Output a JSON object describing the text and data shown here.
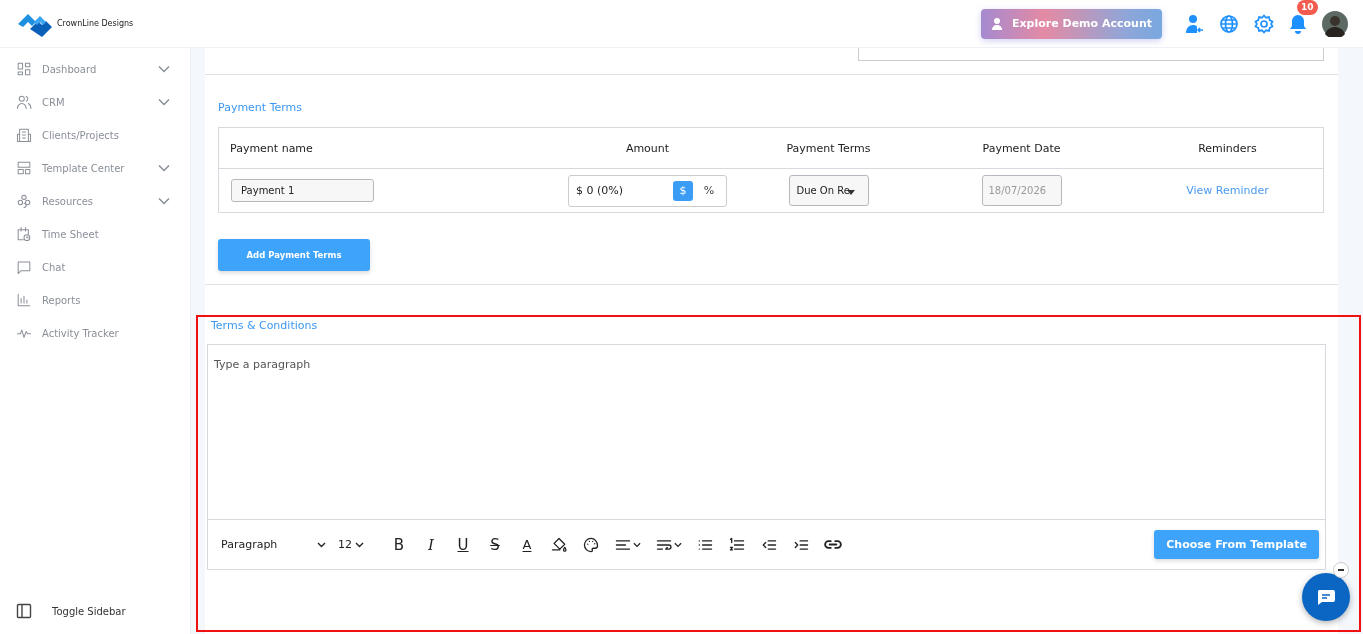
{
  "header": {
    "brand": "CrownLine Designs",
    "demo_button": "Explore Demo Account",
    "notification_count": "10"
  },
  "sidebar": {
    "items": [
      {
        "label": "Dashboard",
        "expandable": true
      },
      {
        "label": "CRM",
        "expandable": true
      },
      {
        "label": "Clients/Projects",
        "expandable": false
      },
      {
        "label": "Template Center",
        "expandable": true
      },
      {
        "label": "Resources",
        "expandable": true
      },
      {
        "label": "Time Sheet",
        "expandable": false
      },
      {
        "label": "Chat",
        "expandable": false
      },
      {
        "label": "Reports",
        "expandable": false
      },
      {
        "label": "Activity Tracker",
        "expandable": false
      }
    ],
    "toggle": "Toggle Sidebar"
  },
  "payment_terms": {
    "title": "Payment Terms",
    "columns": [
      "Payment name",
      "Amount",
      "Payment Terms",
      "Payment Date",
      "Reminders"
    ],
    "rows": [
      {
        "name": "Payment 1",
        "amount": "$ 0 (0%)",
        "units": [
          {
            "label": "$",
            "selected": true
          },
          {
            "label": "%",
            "selected": false
          }
        ],
        "terms": "Due On Re",
        "date": "18/07/2026",
        "reminder_link": "View Reminder"
      }
    ],
    "add_button": "Add Payment Terms"
  },
  "terms_conditions": {
    "title": "Terms & Conditions",
    "highlighted": true,
    "placeholder": "Type a paragraph",
    "toolbar": {
      "block_format": "Paragraph",
      "font_size": "12",
      "tools": [
        {
          "kind": "bold",
          "label": "B"
        },
        {
          "kind": "italic",
          "label": "I"
        },
        {
          "kind": "underline",
          "label": "U"
        },
        {
          "kind": "strike",
          "label": "S"
        },
        {
          "kind": "text-color",
          "label": "A"
        },
        {
          "kind": "fill"
        },
        {
          "kind": "palette"
        },
        {
          "kind": "align"
        },
        {
          "kind": "wrap"
        },
        {
          "kind": "bullets"
        },
        {
          "kind": "numbers"
        },
        {
          "kind": "outdent"
        },
        {
          "kind": "indent"
        },
        {
          "kind": "link"
        }
      ]
    },
    "template_button": "Choose From Template"
  }
}
